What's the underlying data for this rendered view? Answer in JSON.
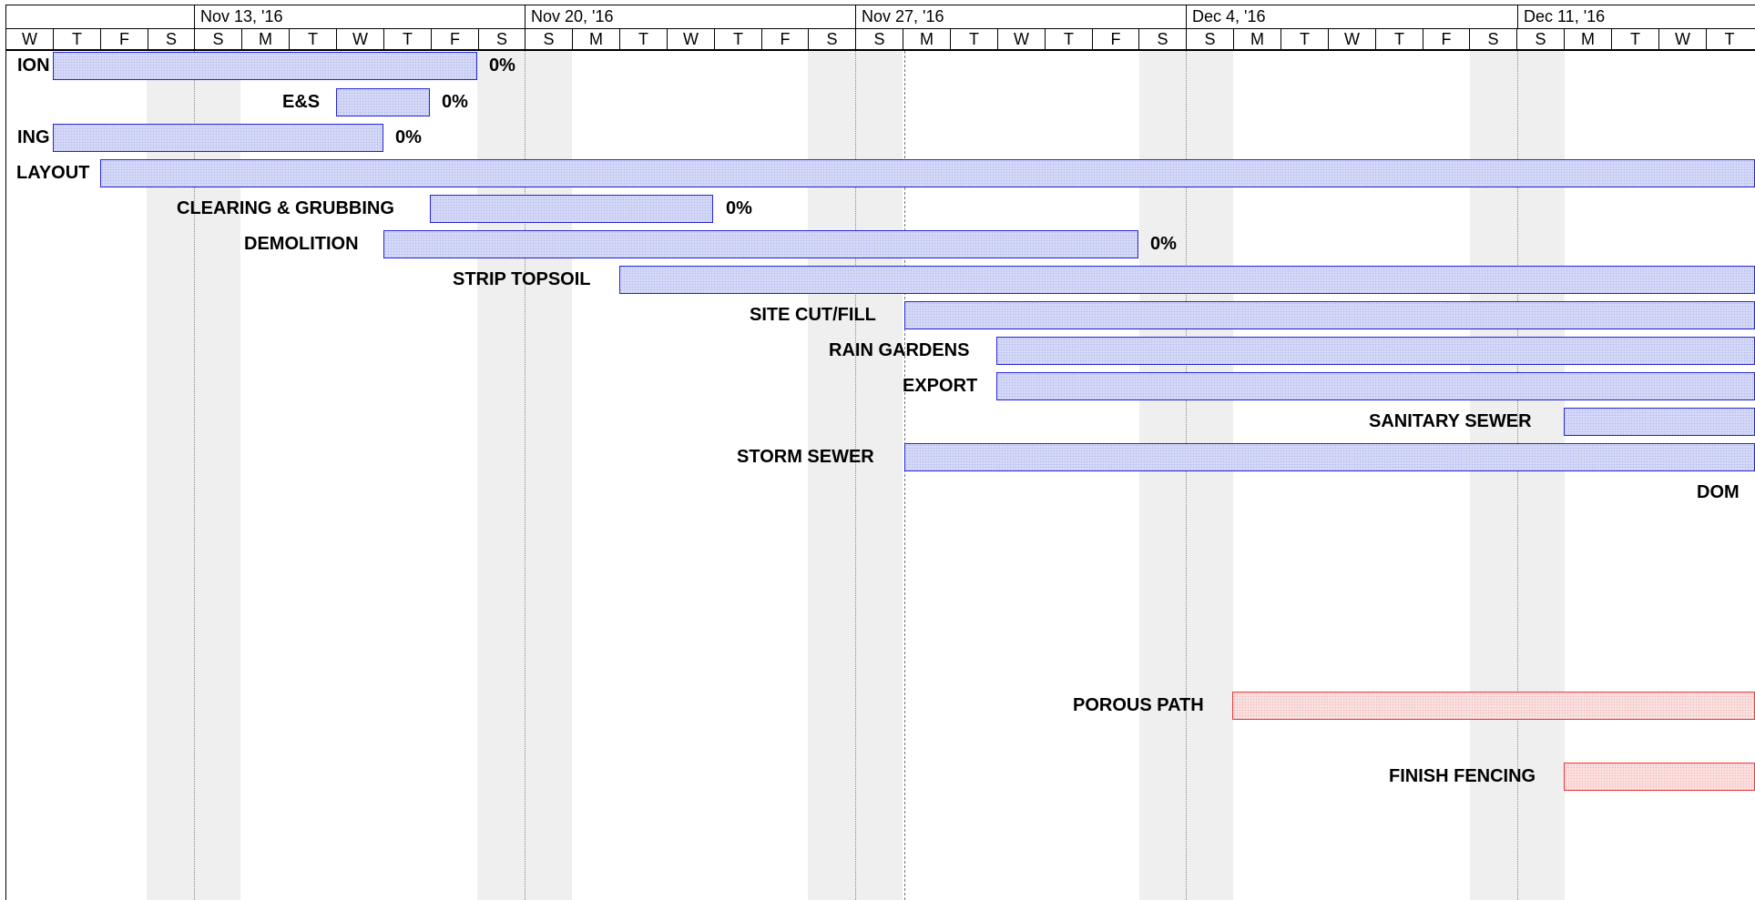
{
  "weeks": [
    "Nov 13, '16",
    "Nov 20, '16",
    "Nov 27, '16",
    "Dec 4, '16",
    "Dec 11, '16"
  ],
  "days": [
    "W",
    "T",
    "F",
    "S",
    "S",
    "M",
    "T",
    "W",
    "T",
    "F",
    "S",
    "S",
    "M",
    "T",
    "W",
    "T",
    "F",
    "S",
    "S",
    "M",
    "T",
    "W",
    "T",
    "F",
    "S",
    "S",
    "M",
    "T",
    "W",
    "T",
    "F",
    "S",
    "S",
    "M",
    "T",
    "W",
    "T"
  ],
  "tasks": [
    {
      "name": "ION",
      "percent": "0%",
      "color": "blue"
    },
    {
      "name": "E&S",
      "percent": "0%",
      "color": "blue"
    },
    {
      "name": "ING",
      "percent": "0%",
      "color": "blue"
    },
    {
      "name": "LAYOUT",
      "percent": "",
      "color": "blue"
    },
    {
      "name": "CLEARING & GRUBBING",
      "percent": "0%",
      "color": "blue"
    },
    {
      "name": "DEMOLITION",
      "percent": "0%",
      "color": "blue"
    },
    {
      "name": "STRIP TOPSOIL",
      "percent": "",
      "color": "blue"
    },
    {
      "name": "SITE CUT/FILL",
      "percent": "",
      "color": "blue"
    },
    {
      "name": "RAIN GARDENS",
      "percent": "",
      "color": "blue"
    },
    {
      "name": "EXPORT",
      "percent": "",
      "color": "blue"
    },
    {
      "name": "SANITARY SEWER",
      "percent": "",
      "color": "blue"
    },
    {
      "name": "STORM SEWER",
      "percent": "",
      "color": "blue"
    },
    {
      "name": "DOM",
      "percent": "",
      "color": "blue"
    },
    {
      "name": "POROUS PATH",
      "percent": "",
      "color": "red"
    },
    {
      "name": "FINISH FENCING",
      "percent": "",
      "color": "red"
    }
  ],
  "colors": {
    "bar_blue_border": "#2525d6",
    "bar_blue_fill": "#d4d8f6",
    "bar_red_border": "#e53a3a",
    "bar_red_fill": "#fbe0e0",
    "weekend_shade": "#efefef"
  }
}
